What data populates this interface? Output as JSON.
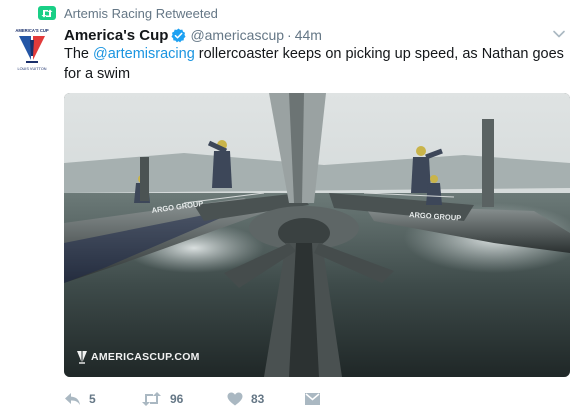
{
  "retweet_context": {
    "icon": "retweet-icon",
    "text": "Artemis Racing Retweeted",
    "color": "#19cf86"
  },
  "author": {
    "display_name": "America's Cup",
    "handle": "@americascup",
    "separator": "·",
    "time": "44m",
    "verified": true,
    "avatar_icon": "americas-cup-logo-icon"
  },
  "tweet": {
    "text_before": "The ",
    "mention": "@artemisracing",
    "text_after": " rollercoaster keeps on picking up speed, as Nathan goes for a swim",
    "mention_color": "#1b95e0"
  },
  "media": {
    "type": "video-still",
    "watermark": "AMERICASCUP.COM",
    "hull_text_left": "ARGO GROUP",
    "hull_text_right": "ARGO GROUP"
  },
  "actions": {
    "reply_count": "5",
    "retweet_count": "96",
    "like_count": "83",
    "icons": [
      "reply-icon",
      "retweet-icon",
      "like-icon",
      "direct-message-icon"
    ]
  },
  "colors": {
    "text_primary": "#14171a",
    "text_secondary": "#657786",
    "link": "#1b95e0",
    "verified": "#1da1f2"
  }
}
